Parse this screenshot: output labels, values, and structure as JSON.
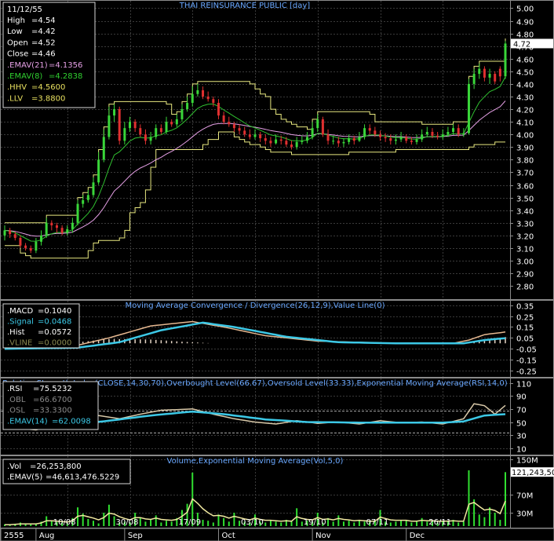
{
  "title": "THAI REINSURANCE PUBLIC [day]",
  "colors": {
    "background": "#000000",
    "frame": "#8a8a8a",
    "grid": "#3a3a3a",
    "price_up": "#39d639",
    "price_down": "#e03030",
    "emav21": "#e6a0e6",
    "emav8": "#30c030",
    "channel": "#e8e880",
    "macd": "#e6b890",
    "signal": "#3cc8e6",
    "hist": "#e8d8c8",
    "rsi": "#d8c8a8",
    "rsi_ema": "#3cc8e6",
    "volume": "#30e030",
    "volume_ema": "#f0e8a0",
    "text": "#ffffff",
    "title": "#6aa8ff"
  },
  "ohlc_box": {
    "date": "11/12/55",
    "rows": [
      {
        "label": "High",
        "value": "=4.54",
        "color": "#ffffff"
      },
      {
        "label": "Low",
        "value": "=4.42",
        "color": "#ffffff"
      },
      {
        "label": "Open",
        "value": "=4.52",
        "color": "#ffffff"
      },
      {
        "label": "Close",
        "value": "=4.46",
        "color": "#ffffff"
      },
      {
        "label": ".EMAV(21)",
        "value": "=4.1356",
        "color": "#e6a0e6"
      },
      {
        "label": ".EMAV(8)",
        "value": "=4.2838",
        "color": "#30d030"
      },
      {
        "label": ".HHV",
        "value": "=4.5600",
        "color": "#e8e060"
      },
      {
        "label": ".LLV",
        "value": "=3.8800",
        "color": "#e8e060"
      }
    ]
  },
  "macd_box": {
    "rows": [
      {
        "label": ".MACD",
        "value": "=0.1040",
        "color": "#ffffff"
      },
      {
        "label": ".Signal",
        "value": "=0.0468",
        "color": "#3cc8e6"
      },
      {
        "label": ".Hist",
        "value": "=0.0572",
        "color": "#ffffff"
      },
      {
        "label": ".VLINE",
        "value": "=0.0000",
        "color": "#8a8a50"
      }
    ]
  },
  "rsi_box": {
    "rows": [
      {
        "label": ".RSI",
        "value": "=75.5232",
        "color": "#ffffff"
      },
      {
        "label": ".OBL",
        "value": "=66.6700",
        "color": "#8a8a8a"
      },
      {
        "label": ".OSL",
        "value": "=33.3300",
        "color": "#8a8a8a"
      },
      {
        "label": ".EMAV(14)",
        "value": "=62.0098",
        "color": "#3cc8e6"
      }
    ]
  },
  "vol_box": {
    "rows": [
      {
        "label": ".Vol",
        "value": "=26,253,800",
        "color": "#ffffff"
      },
      {
        "label": ".EMAV(5)",
        "value": "=46,613,476.5229",
        "color": "#ffffff"
      }
    ]
  },
  "chart_data": [
    {
      "type": "candlestick",
      "title": "THAI REINSURANCE PUBLIC [day]",
      "ylim": [
        2.72,
        5.04
      ],
      "y_ticks": [
        "5.00",
        "4.90",
        "4.80",
        "4.70",
        "4.60",
        "4.50",
        "4.40",
        "4.30",
        "4.20",
        "4.10",
        "4.00",
        "3.90",
        "3.80",
        "3.70",
        "3.60",
        "3.50",
        "3.40",
        "3.30",
        "3.20",
        "3.10",
        "3.00",
        "2.90",
        "2.80"
      ],
      "y_tick_values": [
        5.0,
        4.9,
        4.8,
        4.7,
        4.6,
        4.5,
        4.4,
        4.3,
        4.2,
        4.1,
        4.0,
        3.9,
        3.8,
        3.7,
        3.6,
        3.5,
        3.4,
        3.3,
        3.2,
        3.1,
        3.0,
        2.9,
        2.8
      ],
      "last_price_label": "4.72",
      "last_price": 4.72,
      "close": [
        3.24,
        3.21,
        3.18,
        3.12,
        3.1,
        3.08,
        3.15,
        3.2,
        3.3,
        3.28,
        3.26,
        3.22,
        3.25,
        3.3,
        3.45,
        3.48,
        3.52,
        3.62,
        3.8,
        3.98,
        4.15,
        4.2,
        3.95,
        4.05,
        4.1,
        4.05,
        4.0,
        3.95,
        3.98,
        4.05,
        4.02,
        4.1,
        4.08,
        4.12,
        4.2,
        4.25,
        4.32,
        4.35,
        4.3,
        4.28,
        4.25,
        4.15,
        4.1,
        4.08,
        4.05,
        4.03,
        4.0,
        3.98,
        4.0,
        3.97,
        3.95,
        3.93,
        3.96,
        3.95,
        3.92,
        3.9,
        3.94,
        3.95,
        3.98,
        4.05,
        4.12,
        4.0,
        3.95,
        3.95,
        3.93,
        3.94,
        3.97,
        3.95,
        3.98,
        4.05,
        4.03,
        4.0,
        3.98,
        3.97,
        3.95,
        3.96,
        3.98,
        3.95,
        3.94,
        3.96,
        4.0,
        4.02,
        3.99,
        3.98,
        4.0,
        4.02,
        4.05,
        4.0,
        4.01,
        4.4,
        4.48,
        4.52,
        4.45,
        4.48,
        4.42,
        4.46,
        4.72
      ],
      "open": [
        3.2,
        3.24,
        3.21,
        3.18,
        3.12,
        3.1,
        3.08,
        3.15,
        3.2,
        3.3,
        3.28,
        3.26,
        3.22,
        3.25,
        3.3,
        3.45,
        3.48,
        3.52,
        3.62,
        3.8,
        3.98,
        4.15,
        4.2,
        3.95,
        4.05,
        4.1,
        4.05,
        4.0,
        3.95,
        3.98,
        4.05,
        4.02,
        4.1,
        4.08,
        4.12,
        4.2,
        4.25,
        4.32,
        4.35,
        4.3,
        4.28,
        4.25,
        4.15,
        4.1,
        4.08,
        4.05,
        4.03,
        4.0,
        3.98,
        4.0,
        3.97,
        3.95,
        3.93,
        3.96,
        3.95,
        3.92,
        3.9,
        3.94,
        3.95,
        3.98,
        4.05,
        4.12,
        4.0,
        3.95,
        3.95,
        3.93,
        3.94,
        3.97,
        3.95,
        3.98,
        4.05,
        4.03,
        4.0,
        3.98,
        3.97,
        3.95,
        3.96,
        3.98,
        3.95,
        3.94,
        3.96,
        4.0,
        4.02,
        3.99,
        3.98,
        4.0,
        4.02,
        4.05,
        4.0,
        4.01,
        4.4,
        4.48,
        4.52,
        4.45,
        4.48,
        4.52,
        4.46
      ],
      "high": [
        3.28,
        3.26,
        3.23,
        3.2,
        3.14,
        3.12,
        3.18,
        3.24,
        3.34,
        3.32,
        3.3,
        3.28,
        3.28,
        3.34,
        3.48,
        3.52,
        3.56,
        3.66,
        3.86,
        4.04,
        4.22,
        4.24,
        4.22,
        4.1,
        4.14,
        4.12,
        4.08,
        4.04,
        4.02,
        4.08,
        4.08,
        4.14,
        4.12,
        4.16,
        4.24,
        4.3,
        4.38,
        4.4,
        4.38,
        4.34,
        4.3,
        4.28,
        4.18,
        4.14,
        4.1,
        4.08,
        4.06,
        4.04,
        4.04,
        4.02,
        4.0,
        3.98,
        4.0,
        3.99,
        3.98,
        3.95,
        3.98,
        3.99,
        4.02,
        4.1,
        4.16,
        4.14,
        4.04,
        3.99,
        3.98,
        3.97,
        4.0,
        3.99,
        4.02,
        4.08,
        4.08,
        4.06,
        4.03,
        4.01,
        4.0,
        4.0,
        4.02,
        4.0,
        3.98,
        4.0,
        4.04,
        4.06,
        4.05,
        4.02,
        4.04,
        4.06,
        4.08,
        4.08,
        4.05,
        4.44,
        4.52,
        4.56,
        4.54,
        4.52,
        4.5,
        4.54,
        4.74
      ],
      "low": [
        3.16,
        3.18,
        3.16,
        3.1,
        3.08,
        3.06,
        3.06,
        3.12,
        3.18,
        3.24,
        3.22,
        3.2,
        3.2,
        3.22,
        3.28,
        3.42,
        3.46,
        3.5,
        3.6,
        3.78,
        3.96,
        4.1,
        3.92,
        3.92,
        4.02,
        4.02,
        3.98,
        3.92,
        3.92,
        3.96,
        4.0,
        4.0,
        4.06,
        4.06,
        4.1,
        4.18,
        4.22,
        4.3,
        4.28,
        4.26,
        4.22,
        4.12,
        4.08,
        4.06,
        4.02,
        4.0,
        3.98,
        3.96,
        3.96,
        3.94,
        3.92,
        3.9,
        3.92,
        3.92,
        3.9,
        3.88,
        3.88,
        3.92,
        3.93,
        3.96,
        4.02,
        3.98,
        3.92,
        3.92,
        3.9,
        3.9,
        3.92,
        3.92,
        3.94,
        3.96,
        4.0,
        3.98,
        3.95,
        3.94,
        3.92,
        3.92,
        3.94,
        3.93,
        3.92,
        3.92,
        3.94,
        3.98,
        3.97,
        3.96,
        3.96,
        3.98,
        4.0,
        3.98,
        3.98,
        4.0,
        4.36,
        4.44,
        4.42,
        4.4,
        4.4,
        4.42,
        4.44
      ]
    },
    {
      "type": "line",
      "title": "Moving Average Convergence / Divergence(26,12,9),Value Line(0)",
      "ylim": [
        -0.28,
        0.37
      ],
      "y_ticks": [
        "0.35",
        "0.25",
        "0.15",
        "0.05",
        "-0.05",
        "-0.15",
        "-0.25"
      ],
      "y_tick_values": [
        0.35,
        0.25,
        0.15,
        0.05,
        -0.05,
        -0.15,
        -0.25
      ],
      "series": [
        {
          "name": "MACD",
          "anchors": [
            [
              0,
              -0.05
            ],
            [
              12,
              -0.04
            ],
            [
              20,
              0.05
            ],
            [
              28,
              0.16
            ],
            [
              36,
              0.2
            ],
            [
              42,
              0.15
            ],
            [
              50,
              0.07
            ],
            [
              60,
              0.02
            ],
            [
              75,
              0.0
            ],
            [
              86,
              0.0
            ],
            [
              89,
              0.03
            ],
            [
              92,
              0.08
            ],
            [
              96,
              0.104
            ]
          ]
        },
        {
          "name": "Signal",
          "anchors": [
            [
              0,
              -0.05
            ],
            [
              14,
              -0.04
            ],
            [
              22,
              0.01
            ],
            [
              30,
              0.12
            ],
            [
              38,
              0.19
            ],
            [
              44,
              0.15
            ],
            [
              54,
              0.06
            ],
            [
              64,
              0.01
            ],
            [
              75,
              0.0
            ],
            [
              88,
              0.0
            ],
            [
              92,
              0.03
            ],
            [
              96,
              0.0468
            ]
          ]
        },
        {
          "name": "Hist",
          "anchors": [
            [
              0,
              0.0
            ],
            [
              14,
              0.01
            ],
            [
              20,
              0.04
            ],
            [
              28,
              0.035
            ],
            [
              34,
              0.015
            ],
            [
              40,
              0.0
            ],
            [
              60,
              0.0
            ],
            [
              88,
              0.0
            ],
            [
              90,
              0.02
            ],
            [
              96,
              0.0572
            ]
          ]
        }
      ]
    },
    {
      "type": "line",
      "title": "Relative Strength Index(CLOSE,14,30,70),Overbought Level(66.67),Oversold Level(33.33),Exponential Moving Average(RSI,14,0)",
      "ylim": [
        5,
        113
      ],
      "y_ticks": [
        "110",
        "90",
        "70",
        "50",
        "30",
        "10"
      ],
      "y_tick_values": [
        110,
        90,
        70,
        50,
        30,
        10
      ],
      "overbought": 66.67,
      "oversold": 33.33,
      "series": [
        {
          "name": "RSI",
          "anchors": [
            [
              0,
              42
            ],
            [
              6,
              38
            ],
            [
              12,
              50
            ],
            [
              18,
              60
            ],
            [
              22,
              55
            ],
            [
              26,
              62
            ],
            [
              30,
              68
            ],
            [
              36,
              70
            ],
            [
              40,
              62
            ],
            [
              44,
              55
            ],
            [
              48,
              50
            ],
            [
              52,
              47
            ],
            [
              56,
              52
            ],
            [
              60,
              48
            ],
            [
              64,
              50
            ],
            [
              68,
              47
            ],
            [
              72,
              52
            ],
            [
              76,
              49
            ],
            [
              80,
              50
            ],
            [
              84,
              47
            ],
            [
              88,
              55
            ],
            [
              90,
              78
            ],
            [
              92,
              75
            ],
            [
              94,
              62
            ],
            [
              96,
              75.5
            ]
          ]
        },
        {
          "name": "EMAV(14)",
          "anchors": [
            [
              0,
              44
            ],
            [
              10,
              43
            ],
            [
              20,
              52
            ],
            [
              28,
              60
            ],
            [
              36,
              66
            ],
            [
              42,
              62
            ],
            [
              50,
              54
            ],
            [
              58,
              50
            ],
            [
              70,
              49
            ],
            [
              84,
              49
            ],
            [
              88,
              51
            ],
            [
              92,
              60
            ],
            [
              96,
              62.0
            ]
          ]
        }
      ]
    },
    {
      "type": "bar",
      "title": "Volume,Exponential Moving Average(Vol,5,0)",
      "ylim": [
        0,
        155
      ],
      "y_ticks": [
        "150M",
        "70M",
        "30M"
      ],
      "y_tick_values": [
        150,
        70,
        30
      ],
      "last_value_label": "121,243,50",
      "last_value": 121.24,
      "x_labels": [
        "10/08",
        "30/08",
        "17/09",
        "03/10",
        "19/10",
        "07/11",
        "26/11"
      ],
      "x_label_index": [
        12,
        24,
        36,
        48,
        60,
        72,
        84
      ],
      "values": [
        4,
        3,
        5,
        8,
        4,
        6,
        5,
        10,
        22,
        12,
        9,
        8,
        6,
        18,
        42,
        28,
        16,
        12,
        6,
        30,
        48,
        22,
        8,
        10,
        9,
        30,
        18,
        10,
        14,
        24,
        8,
        12,
        10,
        18,
        36,
        50,
        120,
        30,
        14,
        12,
        8,
        26,
        18,
        10,
        30,
        12,
        10,
        8,
        26,
        10,
        8,
        12,
        10,
        8,
        14,
        10,
        40,
        10,
        12,
        10,
        30,
        8,
        18,
        10,
        24,
        10,
        12,
        8,
        14,
        10,
        10,
        12,
        36,
        10,
        8,
        10,
        12,
        14,
        8,
        10,
        18,
        10,
        12,
        8,
        10,
        12,
        14,
        8,
        10,
        125,
        60,
        26,
        20,
        42,
        30,
        14,
        121
      ],
      "ema": [
        3,
        3,
        4,
        5,
        5,
        5,
        5,
        7,
        12,
        12,
        11,
        10,
        9,
        12,
        22,
        24,
        21,
        18,
        14,
        19,
        29,
        27,
        21,
        17,
        14,
        19,
        19,
        16,
        15,
        18,
        15,
        14,
        13,
        15,
        22,
        31,
        61,
        51,
        39,
        30,
        23,
        24,
        22,
        18,
        22,
        19,
        16,
        14,
        18,
        15,
        13,
        13,
        12,
        11,
        12,
        11,
        21,
        17,
        15,
        14,
        19,
        15,
        16,
        14,
        17,
        15,
        14,
        12,
        13,
        12,
        11,
        11,
        20,
        17,
        14,
        13,
        13,
        13,
        11,
        11,
        13,
        12,
        12,
        11,
        11,
        11,
        12,
        11,
        11,
        49,
        53,
        44,
        36,
        38,
        35,
        28,
        56
      ]
    }
  ],
  "date_axis": {
    "labels": [
      "2555",
      "Aug",
      "Sep",
      "Oct",
      "Nov",
      "Dec"
    ],
    "label_index": [
      0,
      6,
      23,
      41,
      59,
      77
    ]
  }
}
